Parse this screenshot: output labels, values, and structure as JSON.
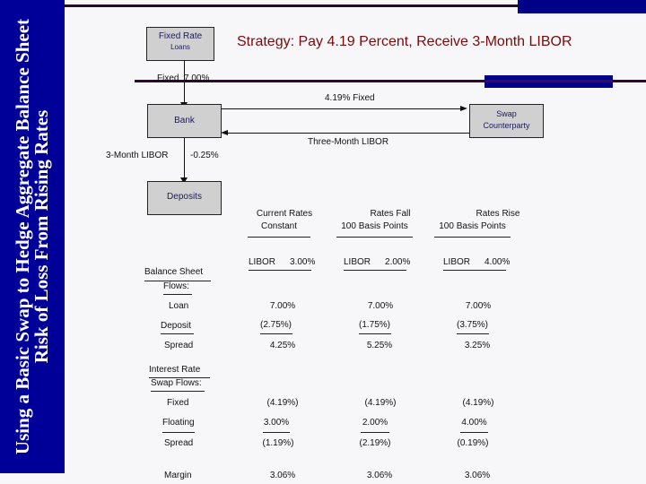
{
  "sidebar": {
    "title": "Using a Basic Swap to Hedge Aggregate Balance Sheet Risk of Loss From Rising Rates"
  },
  "header": {
    "title": "Strategy: Pay 4.19 Percent, Receive 3-Month LIBOR"
  },
  "colors": {
    "sidebar": "#000099",
    "title": "#7a0a0a",
    "rule": "#2a0a2a",
    "box": "#d0d0d0"
  },
  "diagram": {
    "loans_box": {
      "line1": "Fixed Rate",
      "line2": "Loans"
    },
    "loans_flow": "Fixed  7.00%",
    "bank_box": "Bank",
    "counterparty_box": {
      "line1": "Swap",
      "line2": "Counterparty"
    },
    "pay_fixed": "4.19% Fixed",
    "receive_float": "Three-Month LIBOR",
    "deposit_flow_left": "3-Month LIBOR",
    "deposit_flow_right": "-0.25%",
    "deposits_box": "Deposits"
  },
  "table": {
    "scenarios": [
      {
        "header": "Current Rates",
        "sub": "Constant",
        "libor_label": "LIBOR",
        "libor": "3.00%"
      },
      {
        "header": "Rates Fall",
        "sub": "100 Basis Points",
        "libor_label": "LIBOR",
        "libor": "2.00%"
      },
      {
        "header": "Rates Rise",
        "sub": "100 Basis Points",
        "libor_label": "LIBOR",
        "libor": "4.00%"
      }
    ],
    "bs_heading": "Balance Sheet",
    "bs_sub": "Flows:",
    "bs_rows": [
      {
        "label": "Loan",
        "values": [
          "7.00%",
          "7.00%",
          "7.00%"
        ]
      },
      {
        "label": "Deposit",
        "values": [
          "(2.75%)",
          "(1.75%)",
          "(3.75%)"
        ]
      },
      {
        "label": "Spread",
        "values": [
          "4.25%",
          "5.25%",
          "3.25%"
        ]
      }
    ],
    "swap_heading": "Interest Rate",
    "swap_sub": "Swap Flows:",
    "swap_rows": [
      {
        "label": "Fixed",
        "values": [
          "(4.19%)",
          "(4.19%)",
          "(4.19%)"
        ]
      },
      {
        "label": "Floating",
        "values": [
          "3.00%",
          "2.00%",
          "4.00%"
        ]
      },
      {
        "label": "Spread",
        "values": [
          "(1.19%)",
          "(2.19%)",
          "(0.19%)"
        ]
      }
    ],
    "margin": {
      "label": "Margin",
      "values": [
        "3.06%",
        "3.06%",
        "3.06%"
      ]
    }
  }
}
